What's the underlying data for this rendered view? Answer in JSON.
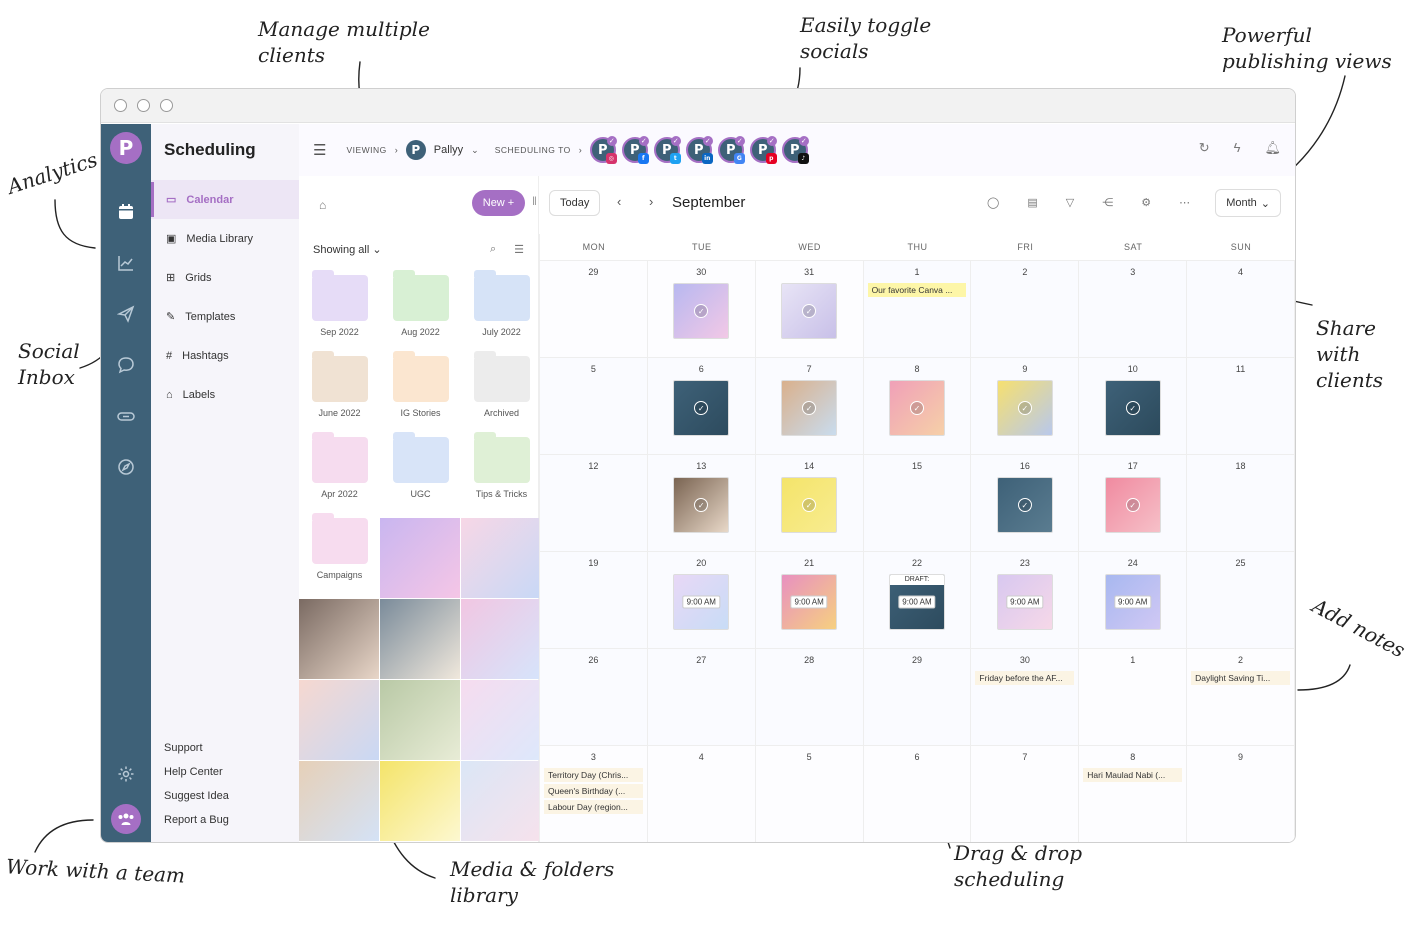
{
  "annotations": {
    "manage_clients": "Manage multiple\nclients",
    "toggle_socials": "Easily toggle\nsocials",
    "publishing_views": "Powerful\npublishing views",
    "analytics": "Analytics",
    "social_inbox": "Social\nInbox",
    "share_clients": "Share\nwith\nclients",
    "add_notes": "Add notes",
    "work_team": "Work with a team",
    "media_library": "Media & folders\nlibrary",
    "drag_drop": "Drag & drop\nscheduling"
  },
  "app": {
    "logo_letter": "P",
    "title": "Scheduling"
  },
  "menu": {
    "items": [
      {
        "label": "Calendar",
        "icon": "calendar-icon"
      },
      {
        "label": "Media Library",
        "icon": "image-icon"
      },
      {
        "label": "Grids",
        "icon": "grid-icon"
      },
      {
        "label": "Templates",
        "icon": "pencil-icon"
      },
      {
        "label": "Hashtags",
        "icon": "hash-icon"
      },
      {
        "label": "Labels",
        "icon": "tag-icon"
      }
    ],
    "footer": [
      "Support",
      "Help Center",
      "Suggest Idea",
      "Report a Bug"
    ]
  },
  "topbar": {
    "viewing_label": "VIEWING",
    "client_name": "Pallyy",
    "scheduling_to_label": "SCHEDULING TO",
    "socials": [
      {
        "network": "instagram",
        "color": "#d6336c",
        "glyph": "◎"
      },
      {
        "network": "facebook",
        "color": "#1877f2",
        "glyph": "f"
      },
      {
        "network": "twitter",
        "color": "#1da1f2",
        "glyph": "t"
      },
      {
        "network": "linkedin",
        "color": "#0a66c2",
        "glyph": "in"
      },
      {
        "network": "google-business",
        "color": "#4285f4",
        "glyph": "G"
      },
      {
        "network": "pinterest",
        "color": "#e60023",
        "glyph": "p"
      },
      {
        "network": "tiktok",
        "color": "#111111",
        "glyph": "♪"
      }
    ]
  },
  "library": {
    "filter_label": "Showing all",
    "folders": [
      {
        "name": "Sep 2022",
        "color": "#e6dcf7"
      },
      {
        "name": "Aug 2022",
        "color": "#d8f0d4"
      },
      {
        "name": "July 2022",
        "color": "#d6e3f7"
      },
      {
        "name": "June 2022",
        "color": "#f0e2d3"
      },
      {
        "name": "IG Stories",
        "color": "#fbe6d0"
      },
      {
        "name": "Archived",
        "color": "#ececec"
      },
      {
        "name": "Apr 2022",
        "color": "#f6dcef"
      },
      {
        "name": "UGC",
        "color": "#d8e4f8"
      },
      {
        "name": "Tips & Tricks",
        "color": "#dff0d6"
      },
      {
        "name": "Campaigns",
        "color": "#f7dcef"
      }
    ],
    "media": [
      {
        "bg": "linear-gradient(135deg,#c9b6f0,#f5c6e6)"
      },
      {
        "bg": "linear-gradient(135deg,#f7d7e6,#c8d8f6)"
      },
      {
        "bg": "linear-gradient(135deg,#7a6a62,#e8d6c8)"
      },
      {
        "bg": "linear-gradient(135deg,#7a8b9a,#f0e8dc)"
      },
      {
        "bg": "linear-gradient(135deg,#f1c6e2,#d6e4fb)"
      },
      {
        "bg": "linear-gradient(135deg,#f6d8d0,#c9d8f4)"
      },
      {
        "bg": "linear-gradient(135deg,#b9c9a6,#e8ecd6)"
      },
      {
        "bg": "linear-gradient(135deg,#f6dcef,#dde8fb)"
      },
      {
        "bg": "linear-gradient(135deg,#e6d0b8,#d4e2f6)"
      },
      {
        "bg": "linear-gradient(135deg,#f4e46a,#fdf8d0)"
      },
      {
        "bg": "linear-gradient(135deg,#dbe6f6,#f6e2ec)"
      },
      {
        "bg": "linear-gradient(135deg,#f4c6d6,#f6ead8)"
      }
    ]
  },
  "calendar": {
    "new_label": "New +",
    "today_label": "Today",
    "month": "September",
    "view_label": "Month",
    "weekdays": [
      "MON",
      "TUE",
      "WED",
      "THU",
      "FRI",
      "SAT",
      "SUN"
    ],
    "weeks": [
      [
        {
          "n": "29",
          "other": true
        },
        {
          "n": "30",
          "other": true,
          "post": {
            "bg": "linear-gradient(135deg,#b8b8f0,#f2c8e6)",
            "mark": "tick"
          }
        },
        {
          "n": "31",
          "other": true,
          "post": {
            "bg": "linear-gradient(135deg,#e8e4f6,#c8c0e8)",
            "mark": "tick"
          }
        },
        {
          "n": "1",
          "note": {
            "text": "Our favorite Canva ...",
            "style": "yellow"
          }
        },
        {
          "n": "2"
        },
        {
          "n": "3"
        },
        {
          "n": "4"
        }
      ],
      [
        {
          "n": "5"
        },
        {
          "n": "6",
          "post": {
            "bg": "linear-gradient(135deg,#3e6178,#2d4b5e)",
            "mark": "tick"
          }
        },
        {
          "n": "7",
          "post": {
            "bg": "linear-gradient(135deg,#d9b08c,#c9dcee)",
            "mark": "tick"
          }
        },
        {
          "n": "8",
          "post": {
            "bg": "linear-gradient(135deg,#f0a0b8,#f6d0a8)",
            "mark": "tick"
          }
        },
        {
          "n": "9",
          "post": {
            "bg": "linear-gradient(135deg,#f6e070,#b8c8ec)",
            "mark": "tick"
          }
        },
        {
          "n": "10",
          "post": {
            "bg": "linear-gradient(135deg,#3e6178,#2c4a5c)",
            "mark": "tick"
          }
        },
        {
          "n": "11"
        }
      ],
      [
        {
          "n": "12"
        },
        {
          "n": "13",
          "post": {
            "bg": "linear-gradient(135deg,#7a6452,#e8d8c8)",
            "mark": "tick"
          }
        },
        {
          "n": "14",
          "post": {
            "bg": "linear-gradient(135deg,#f4e46a,#f8ec90)",
            "mark": "tick"
          }
        },
        {
          "n": "15"
        },
        {
          "n": "16",
          "post": {
            "bg": "linear-gradient(135deg,#3e6178,#5a7c90)",
            "mark": "tick"
          }
        },
        {
          "n": "17",
          "post": {
            "bg": "linear-gradient(135deg,#f08aa0,#f6c0c8)",
            "mark": "tick"
          }
        },
        {
          "n": "18"
        }
      ],
      [
        {
          "n": "19"
        },
        {
          "n": "20",
          "post": {
            "bg": "linear-gradient(135deg,#e8d8f6,#c8dcf6)",
            "mark": "time",
            "time": "9:00 AM"
          }
        },
        {
          "n": "21",
          "post": {
            "bg": "linear-gradient(135deg,#e890c0,#f6d080)",
            "mark": "time",
            "time": "9:00 AM"
          }
        },
        {
          "n": "22",
          "post": {
            "bg": "linear-gradient(135deg,#3e6178,#2d4b5e)",
            "mark": "time",
            "time": "9:00 AM",
            "draft": "DRAFT:"
          }
        },
        {
          "n": "23",
          "post": {
            "bg": "linear-gradient(135deg,#d8c8f0,#f6d8e8)",
            "mark": "time",
            "time": "9:00 AM"
          }
        },
        {
          "n": "24",
          "post": {
            "bg": "linear-gradient(135deg,#a8b8f0,#d0c8f4)",
            "mark": "time",
            "time": "9:00 AM"
          }
        },
        {
          "n": "25"
        }
      ],
      [
        {
          "n": "26"
        },
        {
          "n": "27"
        },
        {
          "n": "28"
        },
        {
          "n": "29"
        },
        {
          "n": "30",
          "note": {
            "text": "Friday before the AF...",
            "style": "beige"
          }
        },
        {
          "n": "1",
          "other": true
        },
        {
          "n": "2",
          "other": true,
          "note": {
            "text": "Daylight Saving Ti...",
            "style": "beige"
          }
        }
      ],
      [
        {
          "n": "3",
          "other": true,
          "notes": [
            "Territory Day (Chris...",
            "Queen's Birthday (...",
            "Labour Day (region..."
          ]
        },
        {
          "n": "4",
          "other": true
        },
        {
          "n": "5",
          "other": true
        },
        {
          "n": "6",
          "other": true
        },
        {
          "n": "7",
          "other": true
        },
        {
          "n": "8",
          "other": true,
          "note": {
            "text": "Hari Maulad Nabi (...",
            "style": "beige"
          }
        },
        {
          "n": "9",
          "other": true
        }
      ]
    ]
  }
}
